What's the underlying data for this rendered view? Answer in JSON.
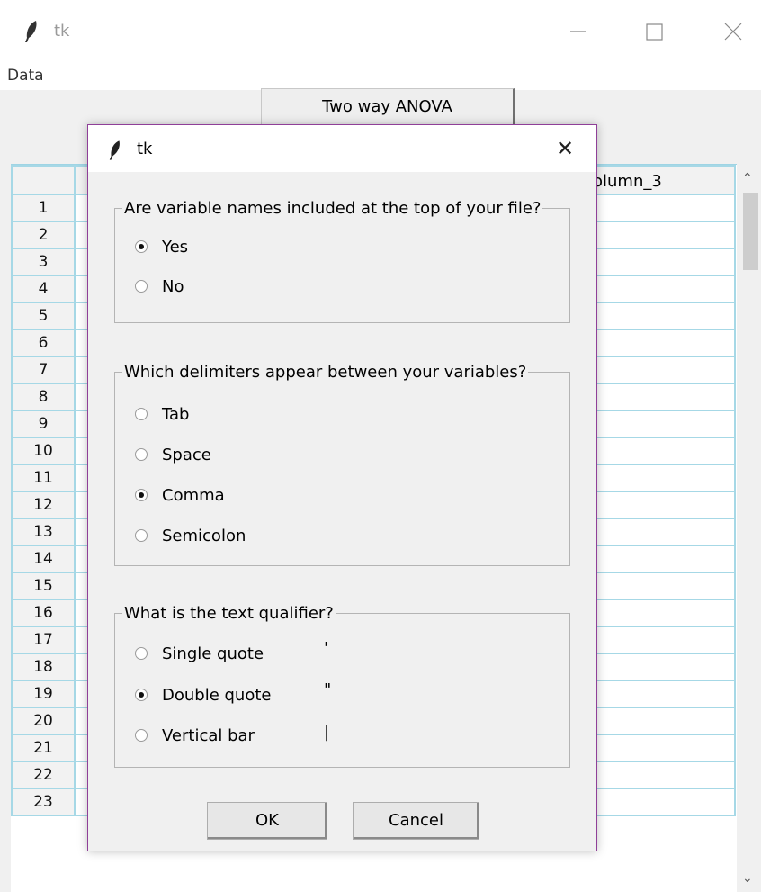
{
  "window": {
    "title": "tk",
    "icon": "feather-icon"
  },
  "menubar": {
    "items": [
      "Data"
    ]
  },
  "toolbar": {
    "anova_button": "Two way ANOVA"
  },
  "table": {
    "visible_header": "olumn_3",
    "rows": [
      "1",
      "2",
      "3",
      "4",
      "5",
      "6",
      "7",
      "8",
      "9",
      "10",
      "11",
      "12",
      "13",
      "14",
      "15",
      "16",
      "17",
      "18",
      "19",
      "20",
      "21",
      "22",
      "23"
    ]
  },
  "dialog": {
    "title": "tk",
    "q1": {
      "legend": "Are variable names included at the top of your file?",
      "options": [
        "Yes",
        "No"
      ],
      "selected": "Yes"
    },
    "q2": {
      "legend": "Which delimiters appear between your variables?",
      "options": [
        "Tab",
        "Space",
        "Comma",
        "Semicolon"
      ],
      "selected": "Comma"
    },
    "q3": {
      "legend": "What is the text qualifier?",
      "options": [
        "Single quote",
        "Double quote",
        "Vertical bar"
      ],
      "chars": [
        "'",
        "\"",
        "|"
      ],
      "selected": "Double quote"
    },
    "buttons": {
      "ok": "OK",
      "cancel": "Cancel"
    }
  },
  "colors": {
    "grid": "#a6d8e6",
    "dialog_border": "#8f3f98",
    "background": "#f0f0f0"
  }
}
